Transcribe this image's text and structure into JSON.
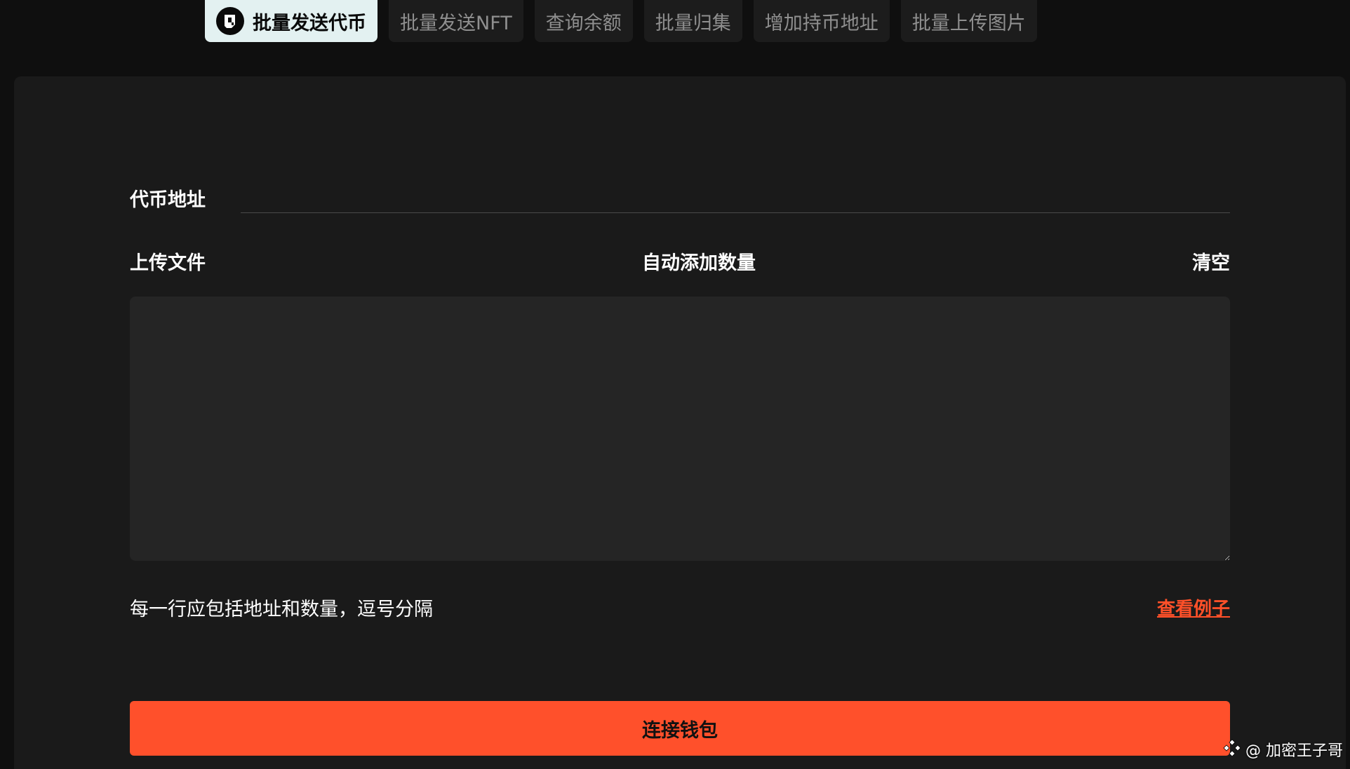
{
  "tabs": [
    {
      "label": "批量发送代币",
      "icon": "wallet-logo-icon",
      "active": true
    },
    {
      "label": "批量发送NFT",
      "active": false
    },
    {
      "label": "查询余额",
      "active": false
    },
    {
      "label": "批量归集",
      "active": false
    },
    {
      "label": "增加持币地址",
      "active": false
    },
    {
      "label": "批量上传图片",
      "active": false
    }
  ],
  "form": {
    "token_address_label": "代币地址",
    "token_address_value": "",
    "upload_file_label": "上传文件",
    "auto_add_amount_label": "自动添加数量",
    "clear_label": "清空",
    "addresses_value": "",
    "hint": "每一行应包括地址和数量，逗号分隔",
    "view_example_label": "查看例子",
    "connect_wallet_label": "连接钱包"
  },
  "watermark": {
    "text": "@ 加密王子哥",
    "icon": "binance-diamond-icon"
  },
  "colors": {
    "background": "#0f0f0f",
    "card": "#1a1a1a",
    "textarea": "#252525",
    "active_tab": "#e3f1f1",
    "accent": "#ff502b"
  }
}
